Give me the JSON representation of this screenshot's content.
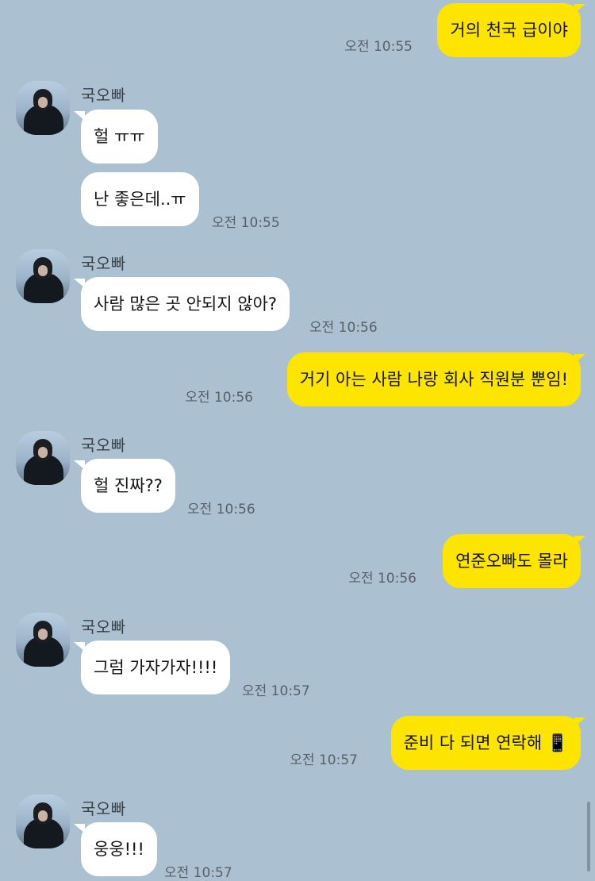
{
  "contact_name": "국오빠",
  "messages": [
    {
      "sender": "me",
      "text": "거의 천국 급이야",
      "time": "오전 10:55"
    },
    {
      "sender": "contact",
      "text": "헐 ㅠㅠ",
      "time": ""
    },
    {
      "sender": "contact",
      "text": "난 좋은데..ㅠ",
      "time": "오전 10:55"
    },
    {
      "sender": "contact",
      "text": "사람 많은 곳 안되지 않아?",
      "time": "오전 10:56"
    },
    {
      "sender": "me",
      "text": "거기 아는 사람 나랑 회사 직원분 뿐임!",
      "time": "오전 10:56"
    },
    {
      "sender": "contact",
      "text": "헐 진짜??",
      "time": "오전 10:56"
    },
    {
      "sender": "me",
      "text": "연준오빠도 몰라",
      "time": "오전 10:56"
    },
    {
      "sender": "contact",
      "text": "그럼 가자가자!!!!",
      "time": "오전 10:57"
    },
    {
      "sender": "me",
      "text": "준비 다 되면 연락해 📱",
      "time": "오전 10:57"
    },
    {
      "sender": "contact",
      "text": "웅웅!!!",
      "time": "오전 10:57"
    }
  ],
  "colors": {
    "background": "#abc1d1",
    "my_bubble": "#fee500",
    "their_bubble": "#ffffff"
  }
}
